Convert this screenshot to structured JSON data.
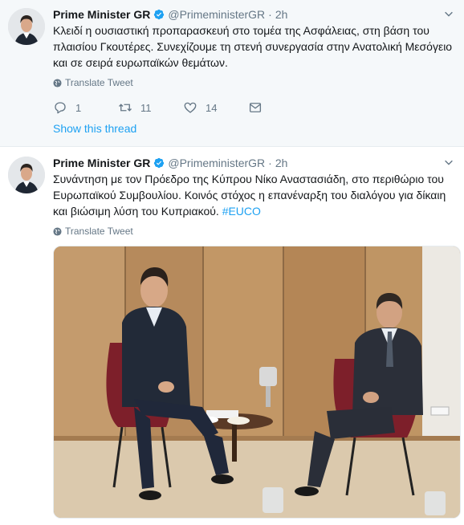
{
  "tweets": [
    {
      "name": "Prime Minister GR",
      "handle": "@PrimeministerGR",
      "dot": "·",
      "time": "2h",
      "text": "Κλειδί η ουσιαστική προπαρασκευή στο τομέα της Ασφάλειας, στη βάση του πλαισίου Γκουτέρες. Συνεχίζουμε τη στενή συνεργασία στην Ανατολική Μεσόγειο και σε σειρά ευρωπαϊκών θεμάτων.",
      "translate": "Translate Tweet",
      "replies": "1",
      "retweets": "11",
      "likes": "14",
      "show_thread": "Show this thread"
    },
    {
      "name": "Prime Minister GR",
      "handle": "@PrimeministerGR",
      "dot": "·",
      "time": "2h",
      "text": "Συνάντηση με τον Πρόεδρο της Κύπρου Νίκο Αναστασιάδη, στο περιθώριο του Ευρωπαϊκού Συμβουλίου. Κοινός στόχος η επανέναρξη του διαλόγου για δίκαιη και βιώσιμη λύση του Κυπριακού.",
      "hashtag": "#EUCO",
      "translate": "Translate Tweet"
    }
  ],
  "colors": {
    "link": "#1da1f2",
    "muted": "#657786",
    "text": "#14171a",
    "highlight_bg": "#f5f8fa"
  },
  "icons": [
    "avatar",
    "verified-badge-icon",
    "chevron-down-icon",
    "globe-icon",
    "reply-icon",
    "retweet-icon",
    "like-icon",
    "message-icon"
  ]
}
